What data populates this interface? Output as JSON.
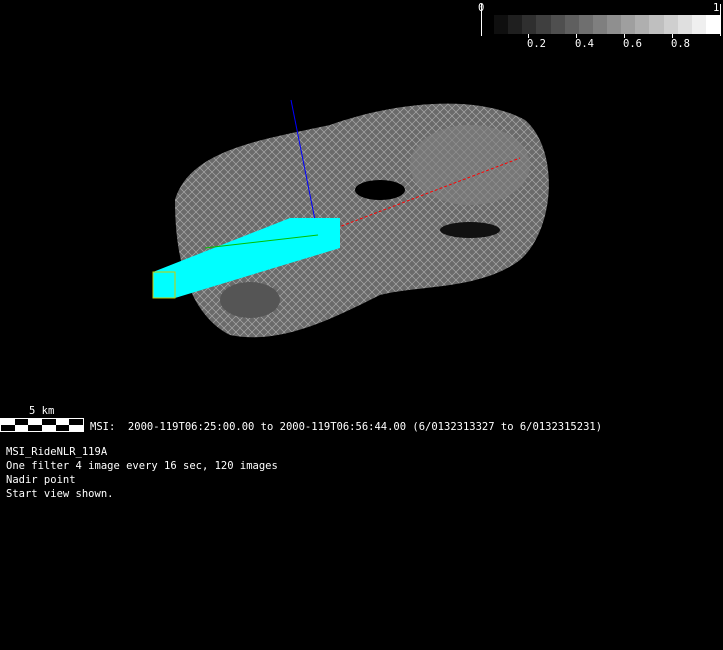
{
  "colorbar": {
    "min_label": "0",
    "max_label": "1",
    "tick_labels": [
      "0.2",
      "0.4",
      "0.6",
      "0.8"
    ],
    "segments": 16
  },
  "scale_bar": {
    "label": "5 km"
  },
  "info": {
    "time_range": "MSI:  2000-119T06:25:00.00 to 2000-119T06:56:44.00 (6/0132313327 to 6/0132315231)",
    "lines": [
      "MSI_RideNLR_119A",
      "One filter 4 image every 16 sec, 120 images",
      "Nadir point",
      "Start view shown."
    ]
  },
  "colors": {
    "footprint": "#00ffff",
    "axis_x": "#ff0000",
    "axis_y": "#00c000",
    "axis_z": "#0000ff"
  }
}
